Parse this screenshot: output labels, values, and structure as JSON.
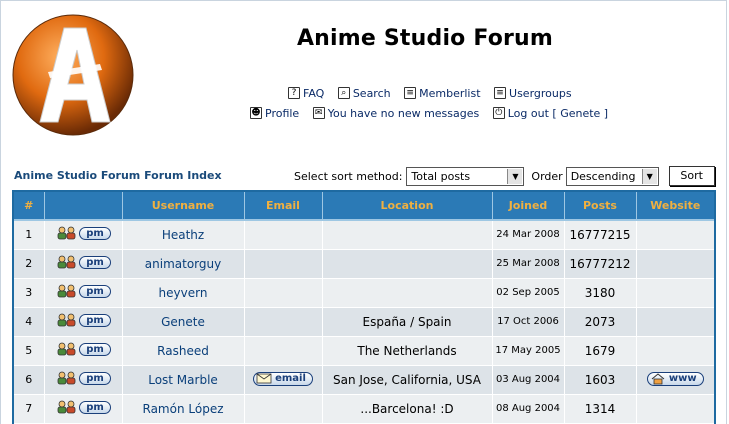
{
  "site": {
    "title": "Anime Studio Forum",
    "logo_letter": "A"
  },
  "nav": {
    "row1": [
      {
        "label": "FAQ",
        "icon": "faq-icon"
      },
      {
        "label": "Search",
        "icon": "search-icon"
      },
      {
        "label": "Memberlist",
        "icon": "memberlist-icon"
      },
      {
        "label": "Usergroups",
        "icon": "usergroups-icon"
      }
    ],
    "row2": [
      {
        "label": "Profile",
        "icon": "profile-icon"
      },
      {
        "label": "You have no new messages",
        "icon": "messages-icon"
      },
      {
        "label": "Log out [ Genete ]",
        "icon": "logout-icon"
      }
    ]
  },
  "breadcrumb": "Anime Studio Forum Forum Index",
  "sort": {
    "method_label": "Select sort method:",
    "method_value": "Total posts",
    "order_label": "Order",
    "order_value": "Descending",
    "button": "Sort"
  },
  "table": {
    "headers": [
      "#",
      "",
      "Username",
      "Email",
      "Location",
      "Joined",
      "Posts",
      "Website"
    ],
    "pm_label": "pm",
    "email_label": "email",
    "www_label": "www",
    "rows": [
      {
        "num": "1",
        "username": "Heathz",
        "email": false,
        "location": "",
        "joined": "24 Mar 2008",
        "posts": "16777215",
        "website": false
      },
      {
        "num": "2",
        "username": "animatorguy",
        "email": false,
        "location": "",
        "joined": "25 Mar 2008",
        "posts": "16777212",
        "website": false
      },
      {
        "num": "3",
        "username": "heyvern",
        "email": false,
        "location": "",
        "joined": "02 Sep 2005",
        "posts": "3180",
        "website": false
      },
      {
        "num": "4",
        "username": "Genete",
        "email": false,
        "location": "España / Spain",
        "joined": "17 Oct 2006",
        "posts": "2073",
        "website": false
      },
      {
        "num": "5",
        "username": "Rasheed",
        "email": false,
        "location": "The Netherlands",
        "joined": "17 May 2005",
        "posts": "1679",
        "website": false
      },
      {
        "num": "6",
        "username": "Lost Marble",
        "email": true,
        "location": "San Jose, California, USA",
        "joined": "03 Aug 2004",
        "posts": "1603",
        "website": true
      },
      {
        "num": "7",
        "username": "Ramón López",
        "email": false,
        "location": "...Barcelona! :D",
        "joined": "08 Aug 2004",
        "posts": "1314",
        "website": false
      }
    ]
  },
  "colors": {
    "header_bg": "#2b7ab6",
    "header_text": "#f0b040",
    "link": "#0a3f7a"
  }
}
